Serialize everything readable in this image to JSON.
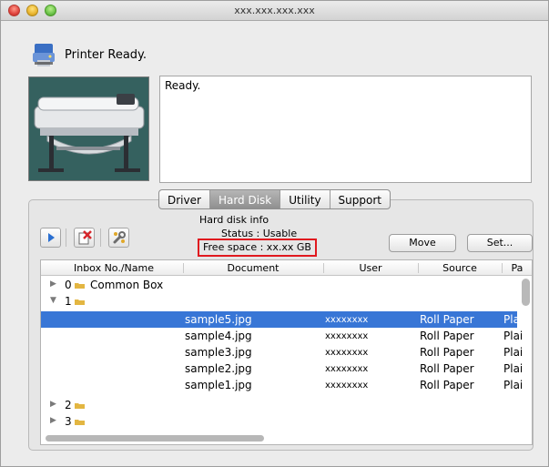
{
  "window": {
    "title": "xxx.xxx.xxx.xxx"
  },
  "status": {
    "title": "Printer Ready.",
    "message": "Ready."
  },
  "tabs": [
    {
      "label": "Driver",
      "active": false
    },
    {
      "label": "Hard Disk",
      "active": true
    },
    {
      "label": "Utility",
      "active": false
    },
    {
      "label": "Support",
      "active": false
    }
  ],
  "hard_disk": {
    "info_label": "Hard disk info",
    "status": "Status : Usable",
    "free_space": "Free space : xx.xx GB"
  },
  "buttons": {
    "move": "Move",
    "set": "Set..."
  },
  "table": {
    "columns": [
      "Inbox No./Name",
      "Document",
      "User",
      "Source",
      "Pa"
    ],
    "boxes": [
      {
        "number": "0",
        "name": "Common Box"
      },
      {
        "number": "1",
        "name": ""
      },
      {
        "number": "2",
        "name": ""
      },
      {
        "number": "3",
        "name": ""
      }
    ],
    "documents": [
      {
        "document": "sample5.jpg",
        "user": "xxxxxxxx",
        "source": "Roll Paper",
        "paper": "Plai"
      },
      {
        "document": "sample4.jpg",
        "user": "xxxxxxxx",
        "source": "Roll Paper",
        "paper": "Plai"
      },
      {
        "document": "sample3.jpg",
        "user": "xxxxxxxx",
        "source": "Roll Paper",
        "paper": "Plai"
      },
      {
        "document": "sample2.jpg",
        "user": "xxxxxxxx",
        "source": "Roll Paper",
        "paper": "Plai"
      },
      {
        "document": "sample1.jpg",
        "user": "xxxxxxxx",
        "source": "Roll Paper",
        "paper": "Plai"
      }
    ]
  },
  "icons": {
    "status": "printer-status-icon",
    "toolbar": [
      "play-icon",
      "delete-job-icon",
      "wrench-icon"
    ]
  },
  "colors": {
    "selection": "#3876d6",
    "highlight_border": "#e0191f",
    "active_tab": "#9a9a9a"
  }
}
